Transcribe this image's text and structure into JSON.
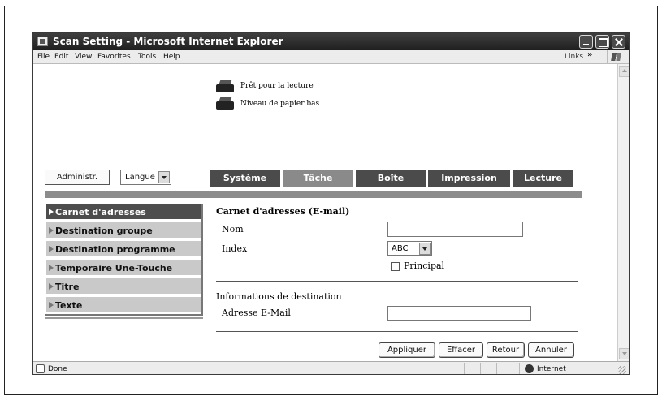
{
  "window": {
    "title": "Scan Setting - Microsoft Internet Explorer"
  },
  "menubar": {
    "items": [
      "File",
      "Edit",
      "View",
      "Favorites",
      "Tools",
      "Help"
    ],
    "links_label": "Links",
    "chevron": "»"
  },
  "status_legend": {
    "ready_label": "Prêt pour la lecture",
    "paper_low_label": "Niveau de papier bas"
  },
  "admin_button_label": "Administr.",
  "language_select": {
    "selected": "Langue"
  },
  "tabs": [
    {
      "label": "Système",
      "active": false
    },
    {
      "label": "Tâche",
      "active": true
    },
    {
      "label": "Boîte",
      "active": false
    },
    {
      "label": "Impression",
      "active": false
    },
    {
      "label": "Lecture",
      "active": false
    }
  ],
  "sidebar": {
    "items": [
      {
        "label": "Carnet d'adresses",
        "active": true
      },
      {
        "label": "Destination groupe",
        "active": false
      },
      {
        "label": "Destination programme",
        "active": false
      },
      {
        "label": "Temporaire Une-Touche",
        "active": false
      },
      {
        "label": "Titre",
        "active": false
      },
      {
        "label": "Texte",
        "active": false
      }
    ]
  },
  "form": {
    "title": "Carnet d'adresses (E-mail)",
    "name_label": "Nom",
    "name_value": "",
    "index_label": "Index",
    "index_value": "ABC",
    "principal_label": "Principal",
    "principal_checked": false,
    "destination_section": "Informations de destination",
    "email_label": "Adresse E-Mail",
    "email_value": ""
  },
  "buttons": {
    "apply": "Appliquer",
    "clear": "Effacer",
    "back": "Retour",
    "cancel": "Annuler"
  },
  "statusbar": {
    "status": "Done",
    "zone": "Internet"
  },
  "colors": {
    "titlebar": "#2b2b2b",
    "active_tab": "#8a8a8a",
    "inactive_tab": "#4b4b4b",
    "active_sidebar": "#4d4d4d",
    "sidebar_item": "#c9c9c9"
  }
}
